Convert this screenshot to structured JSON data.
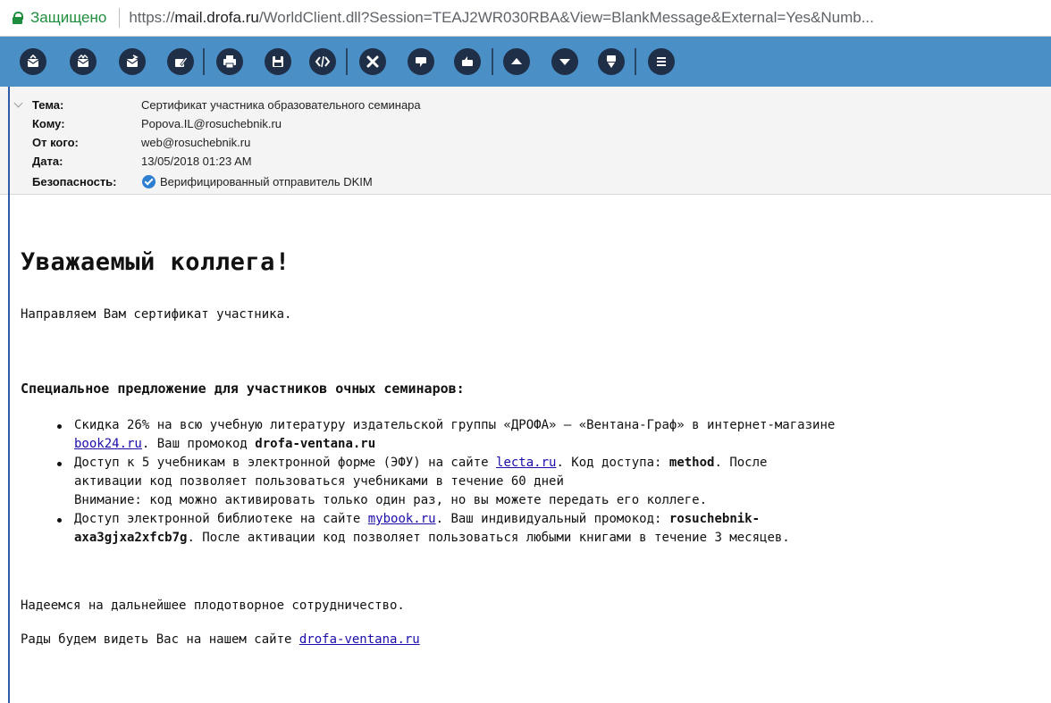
{
  "browser": {
    "secure_label": "Защищено",
    "url_scheme": "https://",
    "url_host": "mail.drofa.ru",
    "url_path": "/WorldClient.dll?Session=TEAJ2WR030RBA&View=BlankMessage&External=Yes&Numb..."
  },
  "toolbar": {
    "buttons": [
      "reply-icon",
      "reply-all-icon",
      "forward-icon",
      "forward-edit-icon",
      "print-icon",
      "save-icon",
      "source-icon",
      "delete-icon",
      "junk-icon",
      "not-junk-icon",
      "previous-icon",
      "next-icon",
      "move-icon",
      "menu-icon"
    ],
    "accent": "#4b8fc7",
    "button_color": "#1f2f48"
  },
  "header": {
    "subject_label": "Тема:",
    "subject": "Сертификат участника образовательного семинара",
    "to_label": "Кому:",
    "to": "Popova.IL@rosuchebnik.ru",
    "from_label": "От кого:",
    "from": "web@rosuchebnik.ru",
    "date_label": "Дата:",
    "date": "13/05/2018 01:23 AM",
    "security_label": "Безопасность:",
    "security": "Верифицированный отправитель DKIM"
  },
  "message": {
    "greeting": "Уважаемый коллега!",
    "intro": "Направляем Вам сертификат участника.",
    "offer_title": "Специальное предложение для участников очных семинаров:",
    "offers": [
      {
        "line1": "Скидка 26% на всю учебную литературу издательской группы «ДРОФА» – «Вентана-Граф» в интернет-магазине",
        "link": "book24.ru",
        "after_link": ". Ваш промокод ",
        "code": "drofa-ventana.ru"
      },
      {
        "before_link": "Доступ к 5 учебникам в электронной форме (ЭФУ) на сайте ",
        "link": "lecta.ru",
        "after_link": ". Код доступа: ",
        "code": "method",
        "after_code": ". После",
        "line2": "активации код позволяет пользоваться учебниками в течение 60 дней",
        "line3": "Внимание: код можно активировать только один раз, но вы можете передать его коллеге."
      },
      {
        "before_link": "Доступ электронной библиотеке на сайте ",
        "link": "mybook.ru",
        "after_link": ". Ваш индивидуальный промокод: ",
        "code_part1": "rosuchebnik-",
        "code_part2": "axa3gjxa2xfcb7g",
        "after_code": ". После активации код позволяет пользоваться любыми книгами в течение 3 месяцев."
      }
    ],
    "closing": "Надеемся на дальнейшее плодотворное сотрудничество.",
    "visit_text": "Рады будем видеть Вас на нашем сайте ",
    "visit_link": "drofa-ventana.ru"
  }
}
